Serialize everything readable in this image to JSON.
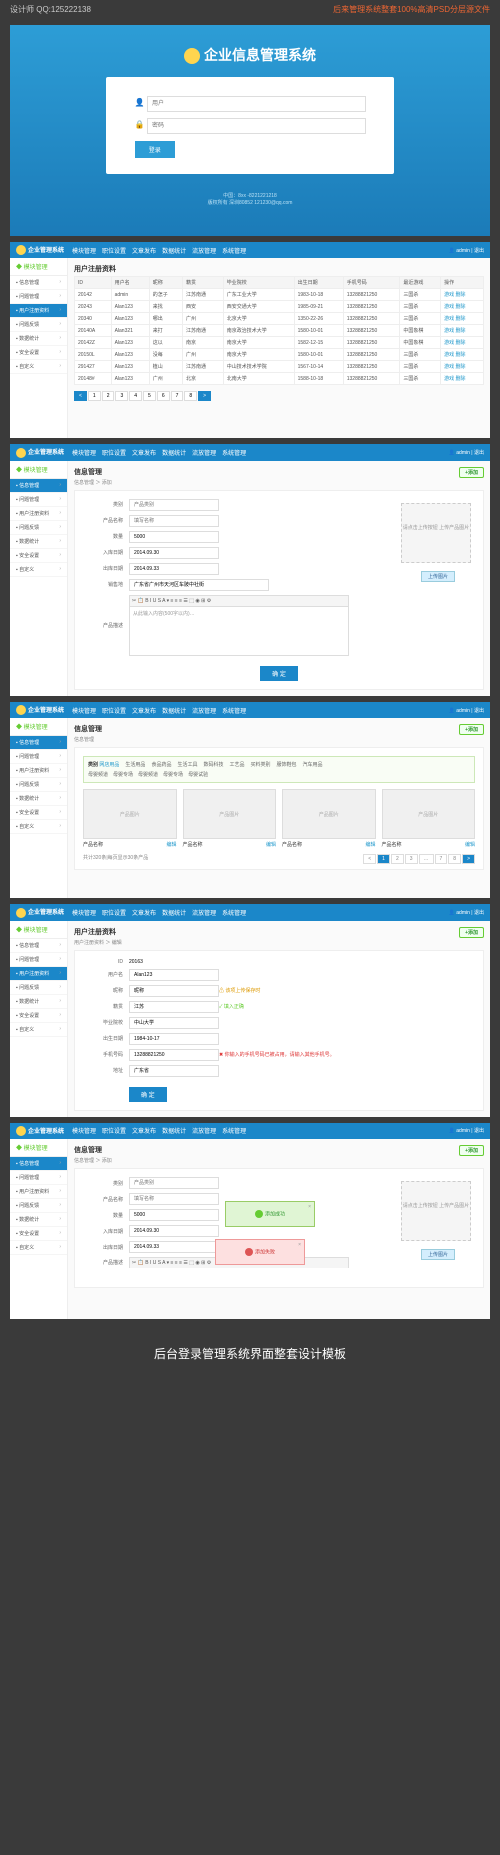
{
  "header": {
    "left": "设计师 QQ:125222138",
    "right": "后来管理系统整套100%高清PSD分层源文件"
  },
  "login": {
    "title": "企业信息管理系统",
    "user_ph": "用户",
    "pw_ph": "密码",
    "btn": "登录",
    "ft1": "中国：8xx -8221221218",
    "ft2": "版权所有 深圳80852 121230@qq.com"
  },
  "app": {
    "name": "企业管理系统",
    "user": "admin",
    "logout": "退出"
  },
  "nav": [
    "模块管理",
    "职位设置",
    "文章发布",
    "数据统计",
    "流放管理",
    "系统管理"
  ],
  "side": {
    "hd": "模块管理",
    "items": [
      "信息管理",
      "问题管理",
      "用户注册资料",
      "问题反馈",
      "数据统计",
      "安全设置",
      "自定义"
    ]
  },
  "s2": {
    "title": "用户注册资料",
    "cols": [
      "ID",
      "用户名",
      "昵称",
      "籍贯",
      "毕业院校",
      "出生日期",
      "手机号码",
      "最近游戏",
      "操作"
    ],
    "rows": [
      [
        "20142",
        "admin",
        "的怎子",
        "江苏南通",
        "广东工业大学",
        "1983-10-18",
        "13288821250",
        "三国杀",
        "游戏 删除"
      ],
      [
        "20243",
        "Alan123",
        "来找",
        "西安",
        "西安交通大学",
        "1985-09-21",
        "13288821250",
        "三国杀",
        "游戏 删除"
      ],
      [
        "20340",
        "Alan123",
        "哪出",
        "广州",
        "北京大学",
        "1350-22-26",
        "13288821250",
        "三国杀",
        "游戏 删除"
      ],
      [
        "20140A",
        "Alan321",
        "来打",
        "江苏南通",
        "南京政治技术大学",
        "1580-10-01",
        "13288821250",
        "中国象棋",
        "游戏 删除"
      ],
      [
        "20142Z",
        "Alan123",
        "这以",
        "南京",
        "南京大学",
        "1582-12-15",
        "13288821250",
        "中国象棋",
        "游戏 删除"
      ],
      [
        "20150L",
        "Alan123",
        "没每",
        "广州",
        "南京大学",
        "1580-10-01",
        "13288821250",
        "三国杀",
        "游戏 删除"
      ],
      [
        "291427",
        "Alan123",
        "植山",
        "江苏南通",
        "中山技术技术学院",
        "1567-10-14",
        "13288821250",
        "三国杀",
        "游戏 删除"
      ],
      [
        "20148#",
        "Alan123",
        "广州",
        "北京",
        "北南大学",
        "1588-10-18",
        "13288821250",
        "三国杀",
        "游戏 删除"
      ]
    ],
    "pages": [
      "<",
      "1",
      "2",
      "3",
      "4",
      "5",
      "6",
      "7",
      "8",
      ">"
    ]
  },
  "s3": {
    "title": "信息管理",
    "crumb": "信息管理 ＞ 添加",
    "add": "+添加",
    "cat_lb": "类别",
    "cat_ph": "产品类别",
    "name_lb": "产品名称",
    "name_ph": "填写名称",
    "qty_lb": "数量",
    "qty_v": "5000",
    "date1_lb": "入库日期",
    "date1_v": "2014.09.30",
    "date2_lb": "出库日期",
    "date2_v": "2014.09.33",
    "area_lb": "销售地",
    "area_v": "广东省广州市天河区车陂中社街",
    "desc_lb": "产品描述",
    "ed_tb": "✂ 📋 B I U S A ▾ ≡ ≡ ≡ ☰ ⬚ ◉ ⊞ ⚙",
    "ed_ph": "从此输入内容(500字以内)…",
    "img_hint": "请点击上传按钮\n上传产品图片",
    "upload": "上传图片",
    "ok": "确 定"
  },
  "s4": {
    "title": "信息管理",
    "crumb": "信息管理",
    "add": "+添加",
    "cat_lb": "类别",
    "cats": [
      "网店用品",
      "生活用品",
      "食品药品",
      "生活工具",
      "数码科技",
      "工艺品",
      "买料类别",
      "服饰鞋包",
      "汽车用品"
    ],
    "cats2": [
      "母婴频道",
      "母婴专场",
      "母婴频道",
      "母婴专场",
      "母婴试验"
    ],
    "prod_img": "产品图片",
    "prod_nm": "产品名称",
    "edit": "编辑",
    "rcd": "共计320条|每页显示30条产品",
    "pages": [
      "<",
      "1",
      "2",
      "3",
      "…",
      "7",
      "8",
      ">"
    ]
  },
  "s5": {
    "title": "用户注册资料",
    "crumb": "用户注册资料 ＞ 编辑",
    "add": "+添加",
    "id_lb": "ID",
    "id_v": "20163",
    "un_lb": "用户名",
    "un_v": "Alan123",
    "nk_lb": "昵称",
    "nk_v": "昵称",
    "nk_w": "该项上传保存时",
    "jg_lb": "籍贯",
    "jg_v": "江苏",
    "jg_ok": "填入正确",
    "sc_lb": "毕业院校",
    "sc_v": "中山大学",
    "bd_lb": "出生日期",
    "bd_v": "1984-10-17",
    "tel_lb": "手机号码",
    "tel_v": "13288821250",
    "tel_e": "你输入的手机号码已被占用，请输入其他手机号。",
    "ad_lb": "地址",
    "ad_v": "广东省",
    "ok": "确 定"
  },
  "s6": {
    "pop_ok": "添加成功",
    "pop_err": "添加失败"
  },
  "footer": "后台登录管理系统界面整套设计模板"
}
